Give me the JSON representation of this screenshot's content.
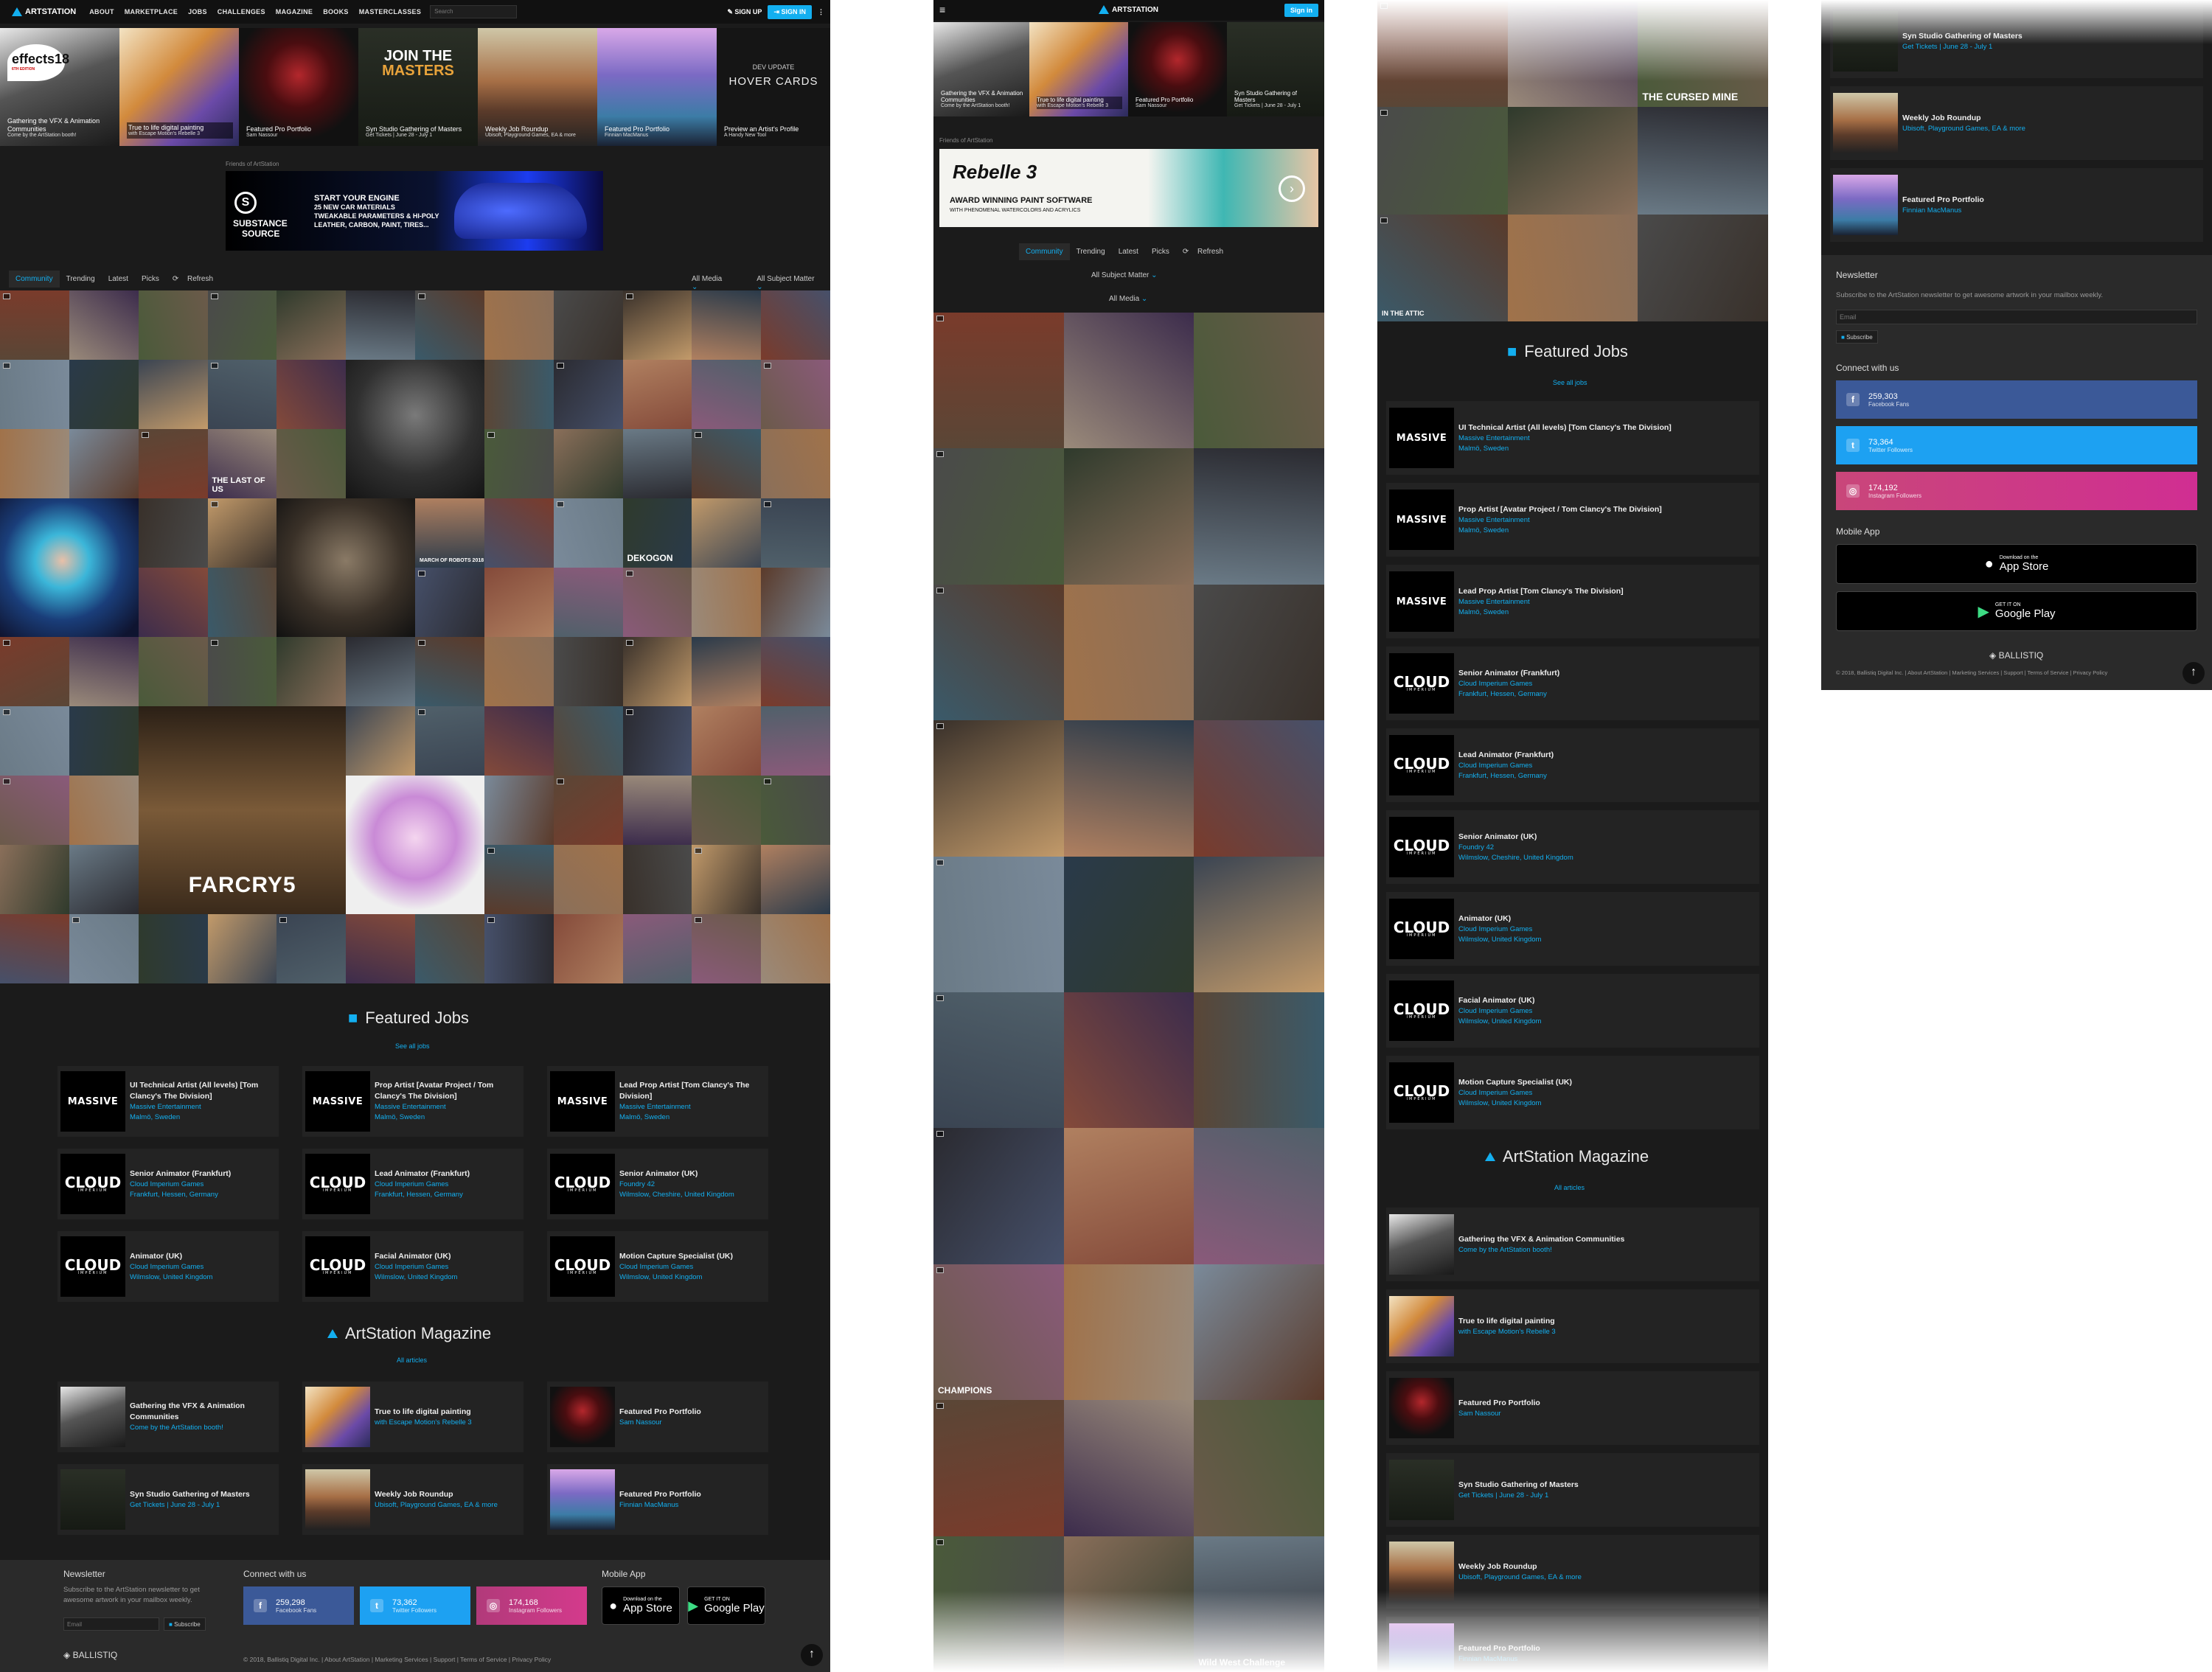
{
  "nav": {
    "brand": "ARTSTATION",
    "items": [
      "ABOUT",
      "MARKETPLACE",
      "JOBS",
      "CHALLENGES",
      "MAGAZINE",
      "BOOKS",
      "MASTERCLASSES"
    ],
    "search_placeholder": "Search",
    "signup": "SIGN UP",
    "signin": "SIGN IN",
    "mobile_signin": "Sign in"
  },
  "features": [
    {
      "title": "Gathering the VFX & Animation Communities",
      "sub": "Come by the ArtStation booth!"
    },
    {
      "title": "True to life digital painting",
      "sub": "with Escape Motion's Rebelle 3"
    },
    {
      "title": "Featured Pro Portfolio",
      "sub": "Sam Nassour"
    },
    {
      "title": "Syn Studio Gathering of Masters",
      "sub": "Get Tickets | June 28 - July 1"
    },
    {
      "title": "Weekly Job Roundup",
      "sub": "Ubisoft, Playground Games, EA & more"
    },
    {
      "title": "Featured Pro Portfolio",
      "sub": "Finnian MacManus"
    },
    {
      "title": "Preview an Artist's Profile",
      "sub": "A Handy New Tool"
    }
  ],
  "tile_overlays": {
    "effects_logo": "effects18",
    "effects_edition": "6TH EDITION",
    "join_masters_1": "JOIN THE",
    "join_masters_2": "MASTERS",
    "dev_update": "DEV UPDATE",
    "hover_cards": "HOVER CARDS"
  },
  "ads": {
    "friends_label": "Friends of ArtStation",
    "substance": {
      "line1": "START YOUR ENGINE",
      "line2": "25 NEW CAR MATERIALS",
      "line3": "TWEAKABLE PARAMETERS & HI-POLY",
      "line4": "LEATHER, CARBON, PAINT, TIRES...",
      "brand": "SUBSTANCE",
      "brand_sub": "SOURCE"
    },
    "rebelle": {
      "brand": "Rebelle 3",
      "tag1": "AWARD WINNING PAINT SOFTWARE",
      "tag2": "WITH PHENOMENAL WATERCOLORS AND ACRYLICS"
    }
  },
  "tabs": [
    "Community",
    "Trending",
    "Latest",
    "Picks",
    "Refresh"
  ],
  "filters": {
    "media": "All Media",
    "subject": "All Subject Matter"
  },
  "grid_labels": {
    "last_of_us": "THE LAST OF US",
    "march_robots": "MARCH OF ROBOTS 2018",
    "far_cry": "FARCRY5",
    "dekogon": "DEKOGON",
    "in_the_attic": "IN THE ATTIC",
    "cursed_mine": "THE CURSED MINE",
    "wild_west": "Wild West Challenge",
    "champions": "CHAMPIONS"
  },
  "jobs": {
    "title": "Featured Jobs",
    "link": "See all jobs",
    "items": [
      {
        "logo": "MASSIVE",
        "title": "UI Technical Artist (All levels) [Tom Clancy's The Division]",
        "company": "Massive Entertainment",
        "location": "Malmö, Sweden"
      },
      {
        "logo": "MASSIVE",
        "title": "Prop Artist [Avatar Project / Tom Clancy's The Division]",
        "company": "Massive Entertainment",
        "location": "Malmö, Sweden"
      },
      {
        "logo": "MASSIVE",
        "title": "Lead Prop Artist [Tom Clancy's The Division]",
        "company": "Massive Entertainment",
        "location": "Malmö, Sweden"
      },
      {
        "logo": "CLOUD",
        "title": "Senior Animator (Frankfurt)",
        "company": "Cloud Imperium Games",
        "location": "Frankfurt, Hessen, Germany"
      },
      {
        "logo": "CLOUD",
        "title": "Lead Animator (Frankfurt)",
        "company": "Cloud Imperium Games",
        "location": "Frankfurt, Hessen, Germany"
      },
      {
        "logo": "CLOUD",
        "title": "Senior Animator (UK)",
        "company": "Foundry 42",
        "location": "Wilmslow, Cheshire, United Kingdom"
      },
      {
        "logo": "CLOUD",
        "title": "Animator (UK)",
        "company": "Cloud Imperium Games",
        "location": "Wilmslow, United Kingdom"
      },
      {
        "logo": "CLOUD",
        "title": "Facial Animator (UK)",
        "company": "Cloud Imperium Games",
        "location": "Wilmslow, United Kingdom"
      },
      {
        "logo": "CLOUD",
        "title": "Motion Capture Specialist (UK)",
        "company": "Cloud Imperium Games",
        "location": "Wilmslow, United Kingdom"
      }
    ],
    "cloud_sub": "IMPERIUM"
  },
  "magazine": {
    "title": "ArtStation Magazine",
    "link": "All articles",
    "items": [
      {
        "title": "Gathering the VFX & Animation Communities",
        "sub": "Come by the ArtStation booth!"
      },
      {
        "title": "True to life digital painting",
        "sub": "with Escape Motion's Rebelle 3"
      },
      {
        "title": "Featured Pro Portfolio",
        "sub": "Sam Nassour"
      },
      {
        "title": "Syn Studio Gathering of Masters",
        "sub": "Get Tickets | June 28 - July 1"
      },
      {
        "title": "Weekly Job Roundup",
        "sub": "Ubisoft, Playground Games, EA & more"
      },
      {
        "title": "Featured Pro Portfolio",
        "sub": "Finnian MacManus"
      }
    ]
  },
  "footer": {
    "newsletter": "Newsletter",
    "newsletter_text": "Subscribe to the ArtStation newsletter to get awesome artwork in your mailbox weekly.",
    "email_placeholder": "Email",
    "subscribe": "Subscribe",
    "connect": "Connect with us",
    "facebook": {
      "count": "259,298",
      "label": "Facebook Fans"
    },
    "twitter": {
      "count": "73,362",
      "label": "Twitter Followers"
    },
    "instagram": {
      "count": "174,168",
      "label": "Instagram Followers"
    },
    "facebook_m": {
      "count": "259,303",
      "label": "Facebook Fans"
    },
    "twitter_m": {
      "count": "73,364",
      "label": "Twitter Followers"
    },
    "instagram_m": {
      "count": "174,192",
      "label": "Instagram Followers"
    },
    "mobile_app": "Mobile App",
    "app_store_small": "Download on the",
    "app_store": "App Store",
    "play_small": "GET IT ON",
    "play": "Google Play",
    "brand": "BALLISTIQ",
    "copyright": "© 2018, Ballistiq Digital Inc. | About ArtStation | Marketing Services | Support | Terms of Service | Privacy Policy"
  },
  "colors": {
    "accent": "#13aff0",
    "bg": "#1b1b1b",
    "facebook": "#3b5998",
    "twitter": "#1da1f2",
    "instagram": "#c13584"
  }
}
